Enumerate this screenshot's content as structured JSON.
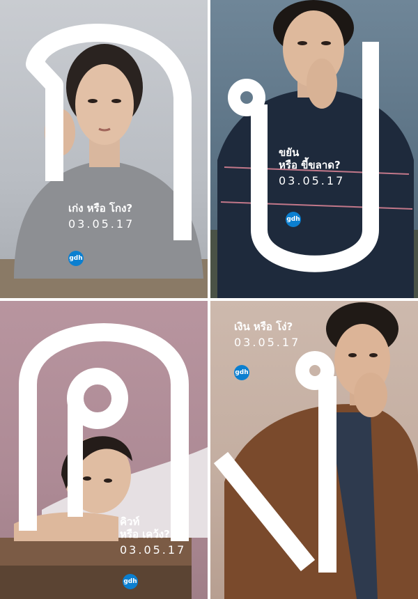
{
  "posters": [
    {
      "tagline": "เก่ง หรือ โกง?",
      "tagline_line2": "",
      "date": "03.05.17",
      "logo": "gdh"
    },
    {
      "tagline": "ขยัน",
      "tagline_line2": "หรือ ขี้ขลาด?",
      "date": "03.05.17",
      "logo": "gdh"
    },
    {
      "tagline": "คิวท์",
      "tagline_line2": "หรือ เคว้ง?",
      "date": "03.05.17",
      "logo": "gdh"
    },
    {
      "tagline": "เงิน หรือ โง่?",
      "tagline_line2": "",
      "date": "03.05.17",
      "logo": "gdh"
    }
  ],
  "colors": {
    "logo_blue": "#0b7fd0",
    "glyph_white": "#ffffff"
  }
}
